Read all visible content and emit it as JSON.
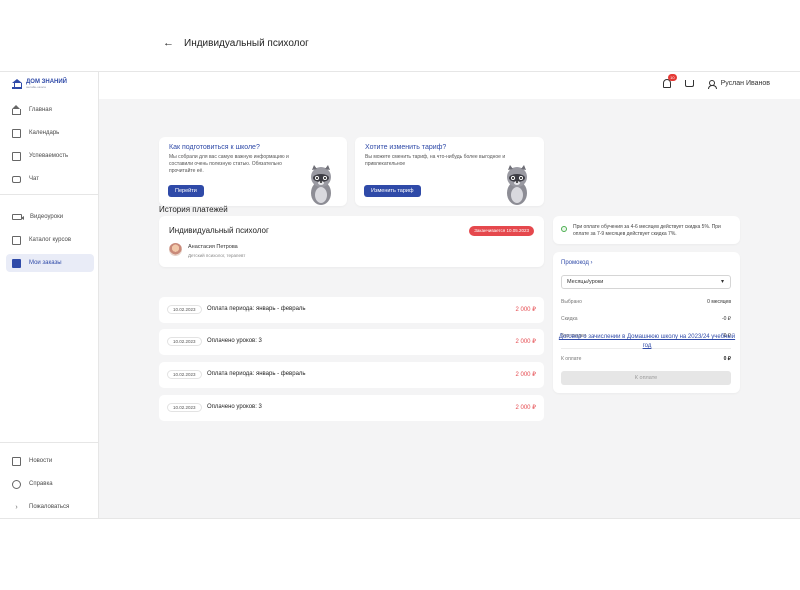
{
  "brand": {
    "name": "ДОМ ЗНАНИЙ",
    "tagline": "онлайн-школа"
  },
  "sidebar": {
    "items": [
      {
        "label": "Главная",
        "icon": "home-icon"
      },
      {
        "label": "Календарь",
        "icon": "calendar-icon"
      },
      {
        "label": "Успеваемость",
        "icon": "progress-icon"
      },
      {
        "label": "Чат",
        "icon": "chat-icon"
      },
      {
        "label": "Видеоуроки",
        "icon": "video-icon"
      },
      {
        "label": "Каталог курсов",
        "icon": "catalog-icon"
      },
      {
        "label": "Мои заказы",
        "icon": "orders-icon",
        "active": true
      }
    ],
    "bottom": [
      {
        "label": "Новости",
        "icon": "news-icon"
      },
      {
        "label": "Справка",
        "icon": "help-icon"
      },
      {
        "label": "Пожаловаться",
        "icon": "arrow-icon"
      }
    ]
  },
  "header": {
    "notifications_count": "10",
    "user_name": "Руслан Иванов"
  },
  "page": {
    "title": "Индивидуальный психолог"
  },
  "promos": [
    {
      "title": "Как подготовиться к школе?",
      "text": "Мы собрали для вас самую важную информацию и составили очень полезную статью. Обязательно прочитайте её.",
      "button": "Перейти"
    },
    {
      "title": "Хотите изменить тариф?",
      "text": "Вы можете сменить тариф, на что-нибудь более выгодное и привлекательное",
      "button": "Изменить тариф"
    }
  ],
  "course": {
    "title": "Индивидуальный психолог",
    "badge": "Заканчивается 10.05.2023",
    "teacher_name": "Анастасия Петрова",
    "teacher_role": "Детский психолог, терапевт"
  },
  "history": {
    "title": "История платежей",
    "rows": [
      {
        "date": "10.02.2023",
        "desc": "Оплата периода: январь - февраль",
        "amount": "2 000 ₽"
      },
      {
        "date": "10.02.2023",
        "desc": "Оплачено уроков: 3",
        "amount": "2 000 ₽"
      },
      {
        "date": "10.02.2023",
        "desc": "Оплата периода: январь - февраль",
        "amount": "2 000 ₽"
      },
      {
        "date": "10.02.2023",
        "desc": "Оплачено уроков: 3",
        "amount": "2 000 ₽"
      }
    ]
  },
  "checkout": {
    "info": "При оплате обучения за 4-6 месяцев действует скидка 5%. При оплате за 7-9 месяцев действует скидка 7%.",
    "promo_label": "Промокод",
    "select_value": "Месяцы/уроки",
    "rows": [
      {
        "label": "Выбрано",
        "value": "0 месяцев"
      },
      {
        "label": "Скидка",
        "value": "-0 ₽"
      },
      {
        "label": "Без скидки",
        "value": "0 ₽"
      }
    ],
    "total_label": "К оплате",
    "total_value": "0 ₽",
    "pay_button": "К оплате",
    "footer_link": "Договор о зачислении в Домашнюю школу на 2023/24 учебный год"
  },
  "colors": {
    "accent": "#2f4aa8",
    "danger": "#e5484d",
    "background": "#f4f4f5"
  }
}
